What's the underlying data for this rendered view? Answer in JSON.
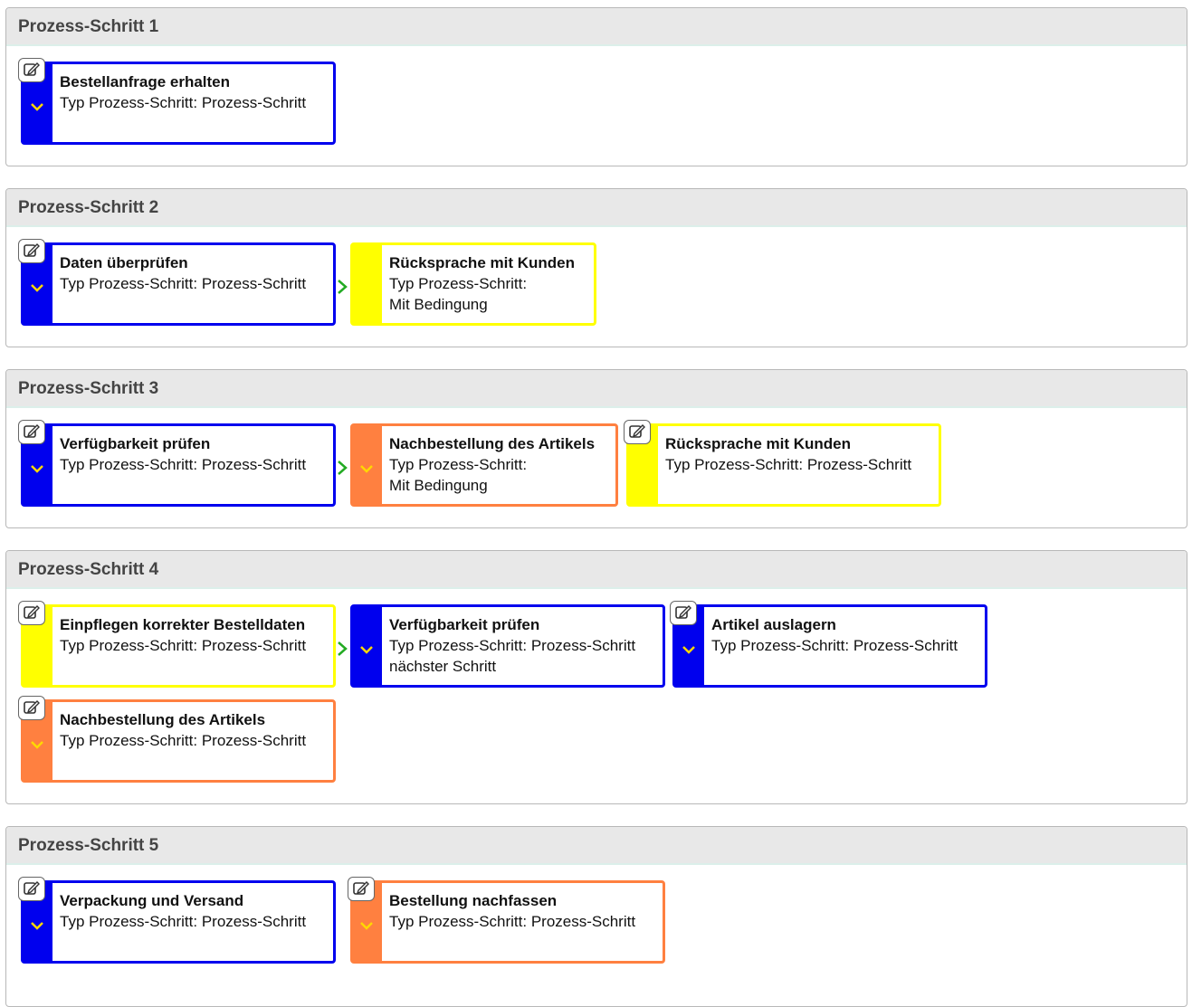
{
  "colors": {
    "blue": "#0000ee",
    "yellow": "#ffff00",
    "orange": "#ff8040",
    "arrow_green": "#22aa22",
    "chevron_yellow": "#ffd700"
  },
  "steps": [
    {
      "title": "Prozess-Schritt 1",
      "cards": [
        {
          "title": "Bestellanfrage erhalten",
          "lines": [
            "Typ Prozess-Schritt: Prozess-Schritt"
          ],
          "color": "blue",
          "edit_icon": "edit-icon",
          "chevron": true
        }
      ]
    },
    {
      "title": "Prozess-Schritt 2",
      "cards": [
        {
          "title": "Daten überprüfen",
          "lines": [
            "Typ Prozess-Schritt: Prozess-Schritt"
          ],
          "color": "blue",
          "edit_icon": "edit-icon",
          "chevron": true
        },
        {
          "title": "Rücksprache mit Kunden",
          "lines": [
            "Typ Prozess-Schritt:",
            "Mit Bedingung"
          ],
          "color": "yellow",
          "chevron": false
        }
      ]
    },
    {
      "title": "Prozess-Schritt 3",
      "cards": [
        {
          "title": "Verfügbarkeit prüfen",
          "lines": [
            "Typ Prozess-Schritt: Prozess-Schritt"
          ],
          "color": "blue",
          "edit_icon": "edit-icon",
          "chevron": true
        },
        {
          "title": "Nachbestellung des Artikels",
          "lines": [
            "Typ Prozess-Schritt:",
            "Mit Bedingung"
          ],
          "color": "orange",
          "chevron": true
        },
        {
          "title": "Rücksprache mit Kunden",
          "lines": [
            "Typ Prozess-Schritt: Prozess-Schritt"
          ],
          "color": "yellow",
          "edit_icon": "edit-icon",
          "chevron": false
        }
      ]
    },
    {
      "title": "Prozess-Schritt 4",
      "cards": [
        {
          "title": "Einpflegen korrekter Bestelldaten",
          "lines": [
            "Typ Prozess-Schritt: Prozess-Schritt"
          ],
          "color": "yellow",
          "edit_icon": "edit-icon",
          "chevron": false
        },
        {
          "title": "Verfügbarkeit prüfen",
          "lines": [
            "Typ Prozess-Schritt: Prozess-Schritt",
            "nächster Schritt"
          ],
          "color": "blue",
          "chevron": true
        },
        {
          "title": "Artikel auslagern",
          "lines": [
            "Typ Prozess-Schritt: Prozess-Schritt"
          ],
          "color": "blue",
          "edit_icon": "edit-icon",
          "chevron": true
        },
        {
          "title": "Nachbestellung des Artikels",
          "lines": [
            "Typ Prozess-Schritt: Prozess-Schritt"
          ],
          "color": "orange",
          "edit_icon": "edit-icon",
          "chevron": true
        }
      ]
    },
    {
      "title": "Prozess-Schritt 5",
      "cards": [
        {
          "title": "Verpackung und Versand",
          "lines": [
            "Typ Prozess-Schritt: Prozess-Schritt"
          ],
          "color": "blue",
          "edit_icon": "edit-icon",
          "chevron": true
        },
        {
          "title": "Bestellung nachfassen",
          "lines": [
            "Typ Prozess-Schritt: Prozess-Schritt"
          ],
          "color": "orange",
          "edit_icon": "edit-icon",
          "chevron": true
        }
      ]
    }
  ]
}
